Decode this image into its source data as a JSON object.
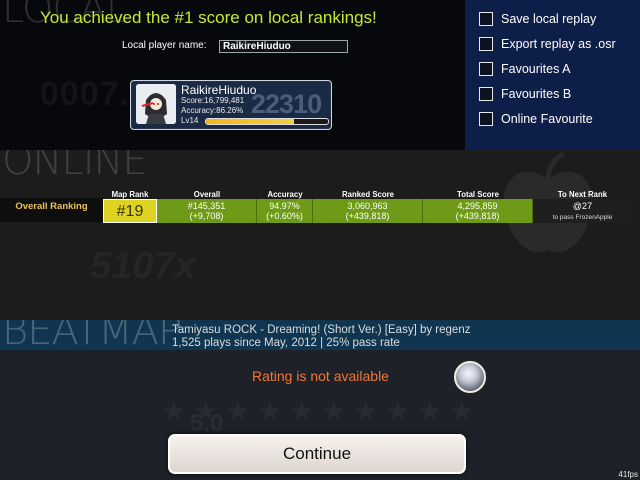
{
  "local": {
    "watermark": "LOCAL",
    "achievement": "You achieved the #1 score on local rankings!",
    "player_name_label": "Local player name:",
    "player_name_value": "RaikireHiuduo"
  },
  "player_card": {
    "name": "RaikireHiuduo",
    "score": "Score:16,799,481",
    "accuracy": "Accuracy:86.26%",
    "level": "Lv14",
    "background_score": "22310",
    "level_progress": 0.72
  },
  "options": [
    {
      "label": "Save local replay"
    },
    {
      "label": "Export replay as .osr"
    },
    {
      "label": "Favourites A"
    },
    {
      "label": "Favourites B"
    },
    {
      "label": "Online Favourite"
    }
  ],
  "online": {
    "watermark": "ONLINE",
    "ranking_label": "Overall Ranking",
    "headers": {
      "map_rank": "Map Rank",
      "overall": "Overall",
      "accuracy": "Accuracy",
      "ranked_score": "Ranked Score",
      "total_score": "Total Score",
      "next_rank": "To Next Rank"
    },
    "values": {
      "map_rank": "#19",
      "overall": "#145,351",
      "overall_delta": "(+9,708)",
      "accuracy": "94.97%",
      "accuracy_delta": "(+0.60%)",
      "ranked_score": "3,060,963",
      "ranked_score_delta": "(+439,818)",
      "total_score": "4,295,859",
      "total_score_delta": "(+439,818)",
      "next_rank": "@27",
      "next_rank_sub": "to pass FrozenApple"
    }
  },
  "beatmap": {
    "watermark": "BEATMAP",
    "title": "Tamiyasu ROCK - Dreaming! (Short Ver.) [Easy] by regenz",
    "stats": "1,525 plays since May, 2012 | 25% pass rate",
    "rating_text": "Rating is not available",
    "star_count": 10
  },
  "continue_label": "Continue",
  "fps": "41fps",
  "colors": {
    "achievement": "#c6ea30",
    "options_bg": "#0d1e49",
    "map_rank_bg": "#dcd322",
    "stat_green": "#6e9a18",
    "rating_text": "#f37635",
    "beatmap_header": "#0f3550"
  }
}
